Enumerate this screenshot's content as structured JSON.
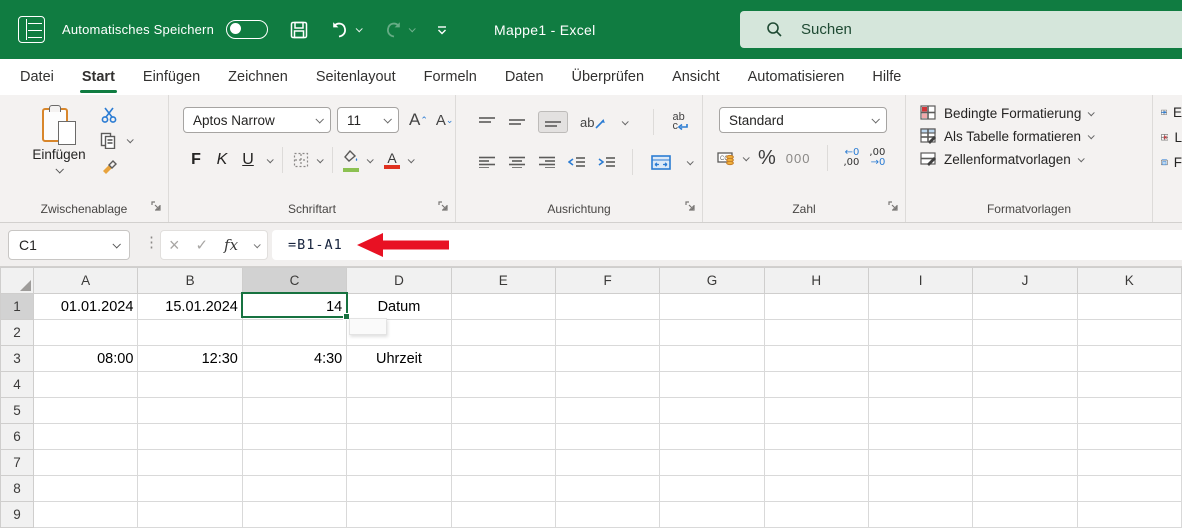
{
  "title_bar": {
    "autosave_label": "Automatisches Speichern",
    "workbook_title": "Mappe1  -  Excel",
    "search_placeholder": "Suchen"
  },
  "tabs": [
    {
      "label": "Datei",
      "active": false
    },
    {
      "label": "Start",
      "active": true
    },
    {
      "label": "Einfügen",
      "active": false
    },
    {
      "label": "Zeichnen",
      "active": false
    },
    {
      "label": "Seitenlayout",
      "active": false
    },
    {
      "label": "Formeln",
      "active": false
    },
    {
      "label": "Daten",
      "active": false
    },
    {
      "label": "Überprüfen",
      "active": false
    },
    {
      "label": "Ansicht",
      "active": false
    },
    {
      "label": "Automatisieren",
      "active": false
    },
    {
      "label": "Hilfe",
      "active": false
    }
  ],
  "ribbon": {
    "clipboard": {
      "paste_label": "Einfügen",
      "group_label": "Zwischenablage"
    },
    "font": {
      "font_name": "Aptos Narrow",
      "font_size": "11",
      "bold": "F",
      "italic": "K",
      "underline": "U",
      "group_label": "Schriftart"
    },
    "alignment": {
      "orientation_glyph": "ab",
      "wrap_top": "ab",
      "wrap_bottom": "c",
      "group_label": "Ausrichtung"
    },
    "number": {
      "format": "Standard",
      "percent": "%",
      "thousands": "000",
      "inc_decimal_top": "←0",
      "inc_decimal_bottom": ",00",
      "dec_decimal_top": ",00",
      "dec_decimal_bottom": "→0",
      "group_label": "Zahl"
    },
    "styles": {
      "conditional": "Bedingte Formatierung",
      "format_table": "Als Tabelle formatieren",
      "cell_styles": "Zellenformatvorlagen",
      "group_label": "Formatvorlagen"
    },
    "cells_partial": {
      "insert": "E",
      "delete": "L",
      "format": "F"
    }
  },
  "formula_bar": {
    "name_box": "C1",
    "cancel": "×",
    "enter": "✓",
    "fx": "fx",
    "formula": "=B1-A1"
  },
  "grid": {
    "columns": [
      "A",
      "B",
      "C",
      "D",
      "E",
      "F",
      "G",
      "H",
      "I",
      "J",
      "K"
    ],
    "row_count": 9,
    "selected_cell": "C1",
    "selected_column": "C",
    "selected_row": 1,
    "cells": {
      "A1": {
        "value": "01.01.2024",
        "align": "right"
      },
      "B1": {
        "value": "15.01.2024",
        "align": "right"
      },
      "C1": {
        "value": "14",
        "align": "right"
      },
      "D1": {
        "value": "Datum",
        "align": "center"
      },
      "A3": {
        "value": "08:00",
        "align": "right"
      },
      "B3": {
        "value": "12:30",
        "align": "right"
      },
      "C3": {
        "value": "4:30",
        "align": "right"
      },
      "D3": {
        "value": "Uhrzeit",
        "align": "center"
      }
    }
  },
  "colors": {
    "excel_green": "#107C41",
    "arrow_red": "#E81123",
    "fill_green": "#8CC152",
    "font_red": "#E0311F"
  }
}
